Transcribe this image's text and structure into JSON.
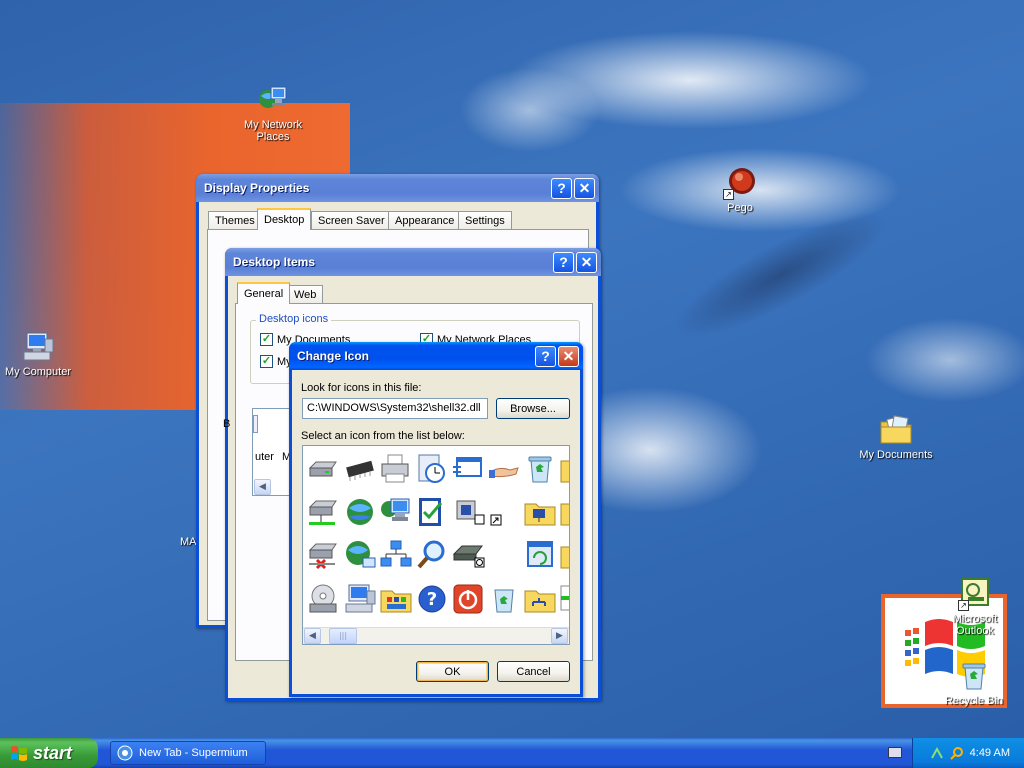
{
  "desktop": {
    "icons": {
      "my_network_places": "My Network Places",
      "my_computer": "My Computer",
      "pego": "Pego",
      "my_documents": "My Documents",
      "microsoft_outlook": "Microsoft Outlook",
      "recycle_bin": "Recycle Bin",
      "partial_ma": "MA"
    }
  },
  "display_properties": {
    "title": "Display Properties",
    "help_glyph": "?",
    "close_glyph": "✕",
    "tabs": [
      "Themes",
      "Desktop",
      "Screen Saver",
      "Appearance",
      "Settings"
    ],
    "active_tab": "Desktop"
  },
  "desktop_items": {
    "title": "Desktop Items",
    "help_glyph": "?",
    "close_glyph": "✕",
    "tabs": [
      "General",
      "Web"
    ],
    "active_tab": "General",
    "group_label": "Desktop icons",
    "checkboxes": [
      {
        "label": "My Documents",
        "checked": true
      },
      {
        "label": "My Network Places",
        "checked": true
      },
      {
        "label": "My",
        "checked": true
      }
    ],
    "partial_text": {
      "b": "B",
      "uter": "uter",
      "m": "M"
    }
  },
  "change_icon": {
    "title": "Change Icon",
    "help_glyph": "?",
    "close_glyph": "✕",
    "look_for_label": "Look for icons in this file:",
    "file_path": "C:\\WINDOWS\\System32\\shell32.dll",
    "browse_label": "Browse...",
    "select_label": "Select an icon from the list below:",
    "ok_label": "OK",
    "cancel_label": "Cancel",
    "scroll_left": "◀",
    "scroll_right": "▶",
    "scroll_thumb": "|||"
  },
  "taskbar": {
    "start_label": "start",
    "tasks": [
      {
        "label": "New Tab - Supermium"
      }
    ],
    "clock": "4:49 AM"
  }
}
